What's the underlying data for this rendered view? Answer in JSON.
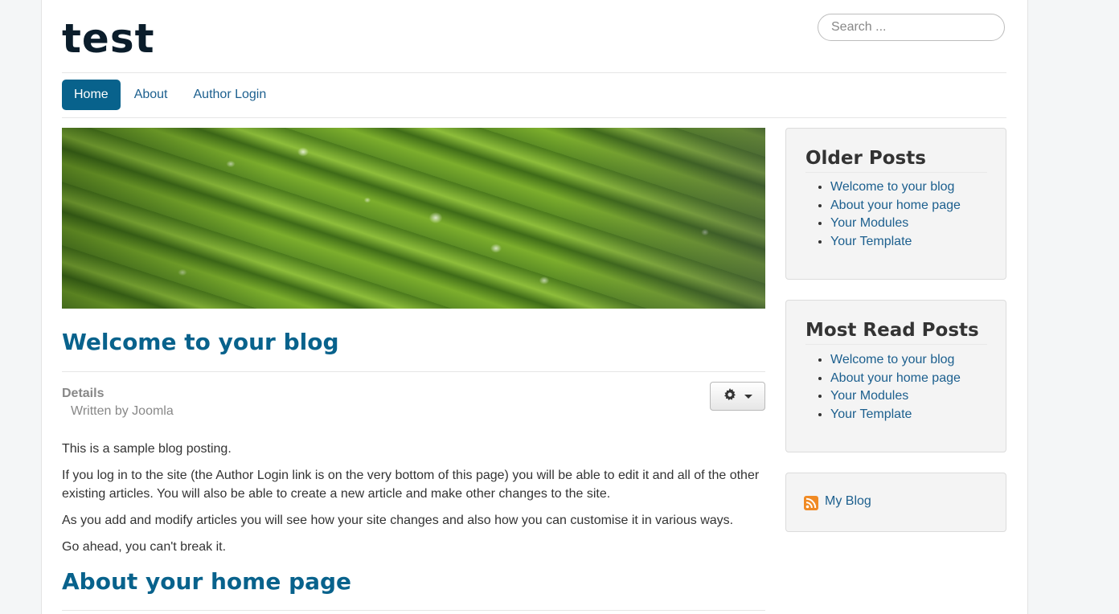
{
  "site": {
    "brand": "test"
  },
  "search": {
    "placeholder": "Search ..."
  },
  "nav": {
    "items": [
      {
        "label": "Home"
      },
      {
        "label": "About"
      },
      {
        "label": "Author Login"
      }
    ]
  },
  "articles": [
    {
      "title": "Welcome to your blog",
      "details_label": "Details",
      "author_line": "Written by Joomla",
      "paragraphs": [
        "This is a sample blog posting.",
        "If you log in to the site (the Author Login link is on the very bottom of this page) you will be able to edit it and all of the other existing articles. You will also be able to create a new article and make other changes to the site.",
        "As you add and modify articles you will see how your site changes and also how you can customise it in various ways.",
        "Go ahead, you can't break it."
      ]
    },
    {
      "title": "About your home page"
    }
  ],
  "sidebar": {
    "older_posts": {
      "title": "Older Posts",
      "items": [
        "Welcome to your blog",
        "About your home page",
        "Your Modules",
        "Your Template"
      ]
    },
    "most_read": {
      "title": "Most Read Posts",
      "items": [
        "Welcome to your blog",
        "About your home page",
        "Your Modules",
        "Your Template"
      ]
    },
    "feed": {
      "label": "My Blog",
      "icon": "rss-icon"
    }
  },
  "colors": {
    "link": "#1c5f8e",
    "accent": "#08628c",
    "brand": "#0b1d2b"
  }
}
